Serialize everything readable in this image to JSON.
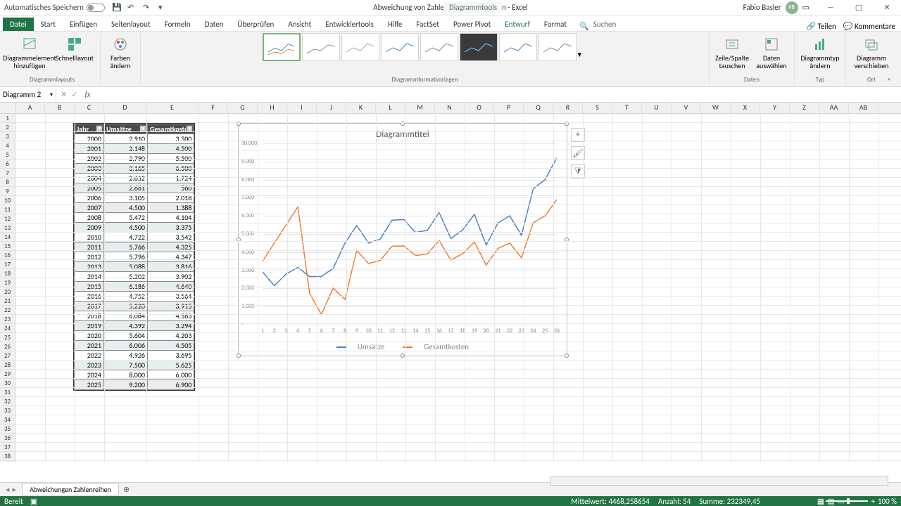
{
  "titlebar": {
    "autosave": "Automatisches Speichern",
    "title": "Abweichung von Zahlenreihen analysieren  -  Excel",
    "contextual": "Diagrammtools",
    "user": "Fabio Basler",
    "user_initials": "FB"
  },
  "tabs": {
    "file": "Datei",
    "list": [
      "Start",
      "Einfügen",
      "Seitenlayout",
      "Formeln",
      "Daten",
      "Überprüfen",
      "Ansicht",
      "Entwicklertools",
      "Hilfe",
      "FactSet",
      "Power Pivot",
      "Entwurf",
      "Format"
    ],
    "active": "Entwurf",
    "search": "Suchen",
    "share": "Teilen",
    "comments": "Kommentare"
  },
  "ribbon": {
    "add_element": "Diagrammelement hinzufügen",
    "quick_layout": "Schnelllayout",
    "change_colors": "Farben ändern",
    "group_layouts": "Diagrammlayouts",
    "group_styles": "Diagrammformatvorlagen",
    "switch_rc": "Zeile/Spalte tauschen",
    "select_data": "Daten auswählen",
    "group_data": "Daten",
    "change_type": "Diagrammtyp ändern",
    "group_type": "Typ",
    "move_chart": "Diagramm verschieben",
    "group_location": "Ort"
  },
  "name_box": "Diagramm 2",
  "columns": [
    "A",
    "B",
    "C",
    "D",
    "E",
    "F",
    "G",
    "H",
    "I",
    "J",
    "K",
    "L",
    "M",
    "N",
    "O",
    "P",
    "Q",
    "R",
    "S",
    "T",
    "U",
    "V",
    "W",
    "X",
    "Y",
    "Z",
    "AA",
    "AB"
  ],
  "table": {
    "headers": [
      "Jahr",
      "Umsätze",
      "Gesamtkosten"
    ],
    "rows": [
      [
        "2000",
        "2.910",
        "3.500"
      ],
      [
        "2001",
        "2.148",
        "4.500"
      ],
      [
        "2002",
        "2.790",
        "5.500"
      ],
      [
        "2003",
        "3.165",
        "6.500"
      ],
      [
        "2004",
        "2.652",
        "1.724"
      ],
      [
        "2005",
        "2.661",
        "560"
      ],
      [
        "2006",
        "3.105",
        "2.018"
      ],
      [
        "2007",
        "4.500",
        "1.388"
      ],
      [
        "2008",
        "5.472",
        "4.104"
      ],
      [
        "2009",
        "4.500",
        "3.375"
      ],
      [
        "2010",
        "4.722",
        "3.542"
      ],
      [
        "2011",
        "5.766",
        "4.325"
      ],
      [
        "2012",
        "5.796",
        "4.347"
      ],
      [
        "2013",
        "5.088",
        "3.816"
      ],
      [
        "2014",
        "5.202",
        "3.902"
      ],
      [
        "2015",
        "6.186",
        "4.640"
      ],
      [
        "2016",
        "4.752",
        "3.564"
      ],
      [
        "2017",
        "5.220",
        "3.915"
      ],
      [
        "2018",
        "6.084",
        "4.563"
      ],
      [
        "2019",
        "4.392",
        "3.294"
      ],
      [
        "2020",
        "5.604",
        "4.203"
      ],
      [
        "2021",
        "6.006",
        "4.505"
      ],
      [
        "2022",
        "4.926",
        "3.695"
      ],
      [
        "2023",
        "7.500",
        "5.625"
      ],
      [
        "2024",
        "8.000",
        "6.000"
      ],
      [
        "2025",
        "9.200",
        "6.900"
      ]
    ]
  },
  "chart_data": {
    "type": "line",
    "title": "Diagrammtitel",
    "x": [
      1,
      2,
      3,
      4,
      5,
      6,
      7,
      8,
      9,
      10,
      11,
      12,
      13,
      14,
      15,
      16,
      17,
      18,
      19,
      20,
      21,
      22,
      23,
      24,
      25,
      26
    ],
    "series": [
      {
        "name": "Umsätze",
        "values": [
          2910,
          2148,
          2790,
          3165,
          2652,
          2661,
          3105,
          4500,
          5472,
          4500,
          4722,
          5766,
          5796,
          5088,
          5202,
          6186,
          4752,
          5220,
          6084,
          4392,
          5604,
          6006,
          4926,
          7500,
          8000,
          9200
        ],
        "color": "#4f81bd"
      },
      {
        "name": "Gesamtkosten",
        "values": [
          3500,
          4500,
          5500,
          6500,
          1724,
          560,
          2018,
          1388,
          4104,
          3375,
          3542,
          4325,
          4347,
          3816,
          3902,
          4640,
          3564,
          3915,
          4563,
          3294,
          4203,
          4505,
          3695,
          5625,
          6000,
          6900
        ],
        "color": "#ed7d31"
      }
    ],
    "ylabels": [
      "-",
      "1.000",
      "2.000",
      "3.000",
      "4.000",
      "5.000",
      "6.000",
      "7.000",
      "8.000",
      "9.000",
      "10.000"
    ],
    "ylim": [
      0,
      10000
    ]
  },
  "sheet": "Abweichungen Zahlenreihen",
  "status": {
    "ready": "Bereit",
    "mean": "Mittelwert: 4468,258654",
    "count": "Anzahl: 54",
    "sum": "Summe: 232349,45",
    "zoom": "100 %"
  }
}
